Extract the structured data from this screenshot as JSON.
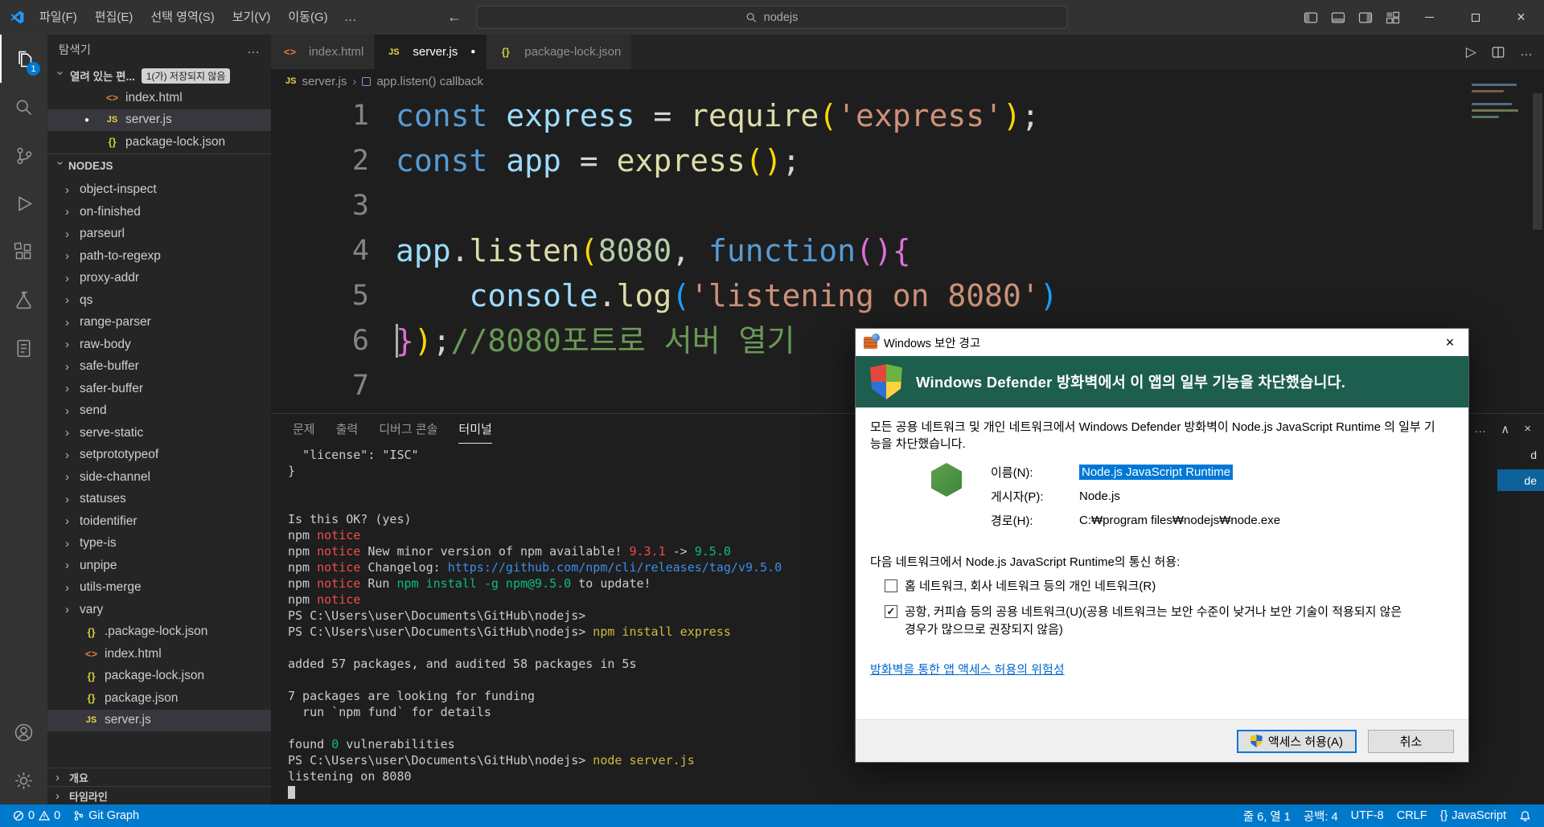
{
  "glyphs": {
    "more": "…",
    "close": "×",
    "back": "←",
    "forward": "→",
    "chevron_up": "∧",
    "run": "▷",
    "dot": "●"
  },
  "titlebar": {
    "menus": [
      "파일(F)",
      "편집(E)",
      "선택 영역(S)",
      "보기(V)",
      "이동(G)"
    ],
    "search": "nodejs"
  },
  "activitybar": {
    "explorer_badge": "1"
  },
  "sidebar": {
    "title": "탐색기",
    "open_editors": {
      "label": "열려 있는 편...",
      "badge": "1(가) 저장되지 않음"
    },
    "open_items": [
      {
        "name": "index.html",
        "icon": "html"
      },
      {
        "name": "server.js",
        "icon": "js",
        "modified": true,
        "selected": true
      },
      {
        "name": "package-lock.json",
        "icon": "json"
      }
    ],
    "project_label": "NODEJS",
    "folders": [
      "object-inspect",
      "on-finished",
      "parseurl",
      "path-to-regexp",
      "proxy-addr",
      "qs",
      "range-parser",
      "raw-body",
      "safe-buffer",
      "safer-buffer",
      "send",
      "serve-static",
      "setprototypeof",
      "side-channel",
      "statuses",
      "toidentifier",
      "type-is",
      "unpipe",
      "utils-merge",
      "vary"
    ],
    "files": [
      {
        "name": ".package-lock.json",
        "icon": "json"
      },
      {
        "name": "index.html",
        "icon": "html"
      },
      {
        "name": "package-lock.json",
        "icon": "json"
      },
      {
        "name": "package.json",
        "icon": "json"
      },
      {
        "name": "server.js",
        "icon": "js",
        "selected": true
      }
    ],
    "bottom_sections": [
      "개요",
      "타임라인"
    ]
  },
  "tabs": [
    {
      "name": "index.html",
      "icon": "html"
    },
    {
      "name": "server.js",
      "icon": "js",
      "active": true,
      "modified": true
    },
    {
      "name": "package-lock.json",
      "icon": "json"
    }
  ],
  "breadcrumb": {
    "file": "server.js",
    "symbol": "app.listen() callback"
  },
  "editor": {
    "lines": [
      {
        "n": "1",
        "t": [
          [
            "kw",
            "const"
          ],
          [
            "pl",
            " "
          ],
          [
            "vr",
            "express"
          ],
          [
            "pl",
            " = "
          ],
          [
            "fn",
            "require"
          ],
          [
            "b1",
            "("
          ],
          [
            "st",
            "'express'"
          ],
          [
            "b1",
            ")"
          ],
          [
            "pl",
            ";"
          ]
        ]
      },
      {
        "n": "2",
        "t": [
          [
            "kw",
            "const"
          ],
          [
            "pl",
            " "
          ],
          [
            "vr",
            "app"
          ],
          [
            "pl",
            " = "
          ],
          [
            "fn",
            "express"
          ],
          [
            "b1",
            "()"
          ],
          [
            "pl",
            ";"
          ]
        ]
      },
      {
        "n": "3",
        "t": []
      },
      {
        "n": "4",
        "t": [
          [
            "vr",
            "app"
          ],
          [
            "pl",
            "."
          ],
          [
            "fn",
            "listen"
          ],
          [
            "b1",
            "("
          ],
          [
            "nu",
            "8080"
          ],
          [
            "pl",
            ", "
          ],
          [
            "kw",
            "function"
          ],
          [
            "b2",
            "(){"
          ]
        ]
      },
      {
        "n": "5",
        "t": [
          [
            "pl",
            "    "
          ],
          [
            "vr",
            "console"
          ],
          [
            "pl",
            "."
          ],
          [
            "fn",
            "log"
          ],
          [
            "b3",
            "("
          ],
          [
            "st",
            "'listening on 8080'"
          ],
          [
            "b3",
            ")"
          ]
        ]
      },
      {
        "n": "6",
        "caret": true,
        "t": [
          [
            "b2",
            "}"
          ],
          [
            "b1",
            ")"
          ],
          [
            "pl",
            ";"
          ],
          [
            "cm",
            "//8080포트로 서버 열기"
          ]
        ]
      },
      {
        "n": "7",
        "t": []
      }
    ]
  },
  "panel": {
    "tabs": [
      {
        "label": "문제"
      },
      {
        "label": "출력"
      },
      {
        "label": "디버그 콘솔"
      },
      {
        "label": "터미널",
        "active": true
      }
    ],
    "frag_rows": [
      {
        "text": "d"
      },
      {
        "text": "de",
        "selected": true
      }
    ]
  },
  "terminal": {
    "lines": [
      [
        [
          "d",
          "  \"license\": \"ISC\""
        ]
      ],
      [
        [
          "d",
          "}"
        ]
      ],
      [],
      [],
      [
        [
          "d",
          "Is this OK? (yes)"
        ]
      ],
      [
        [
          "d",
          "npm "
        ],
        [
          "r",
          "notice"
        ]
      ],
      [
        [
          "d",
          "npm "
        ],
        [
          "r",
          "notice"
        ],
        [
          "d",
          " New minor version of npm available! "
        ],
        [
          "r",
          "9.3.1"
        ],
        [
          "d",
          " -> "
        ],
        [
          "g",
          "9.5.0"
        ]
      ],
      [
        [
          "d",
          "npm "
        ],
        [
          "r",
          "notice"
        ],
        [
          "d",
          " Changelog: "
        ],
        [
          "b",
          "https://github.com/npm/cli/releases/tag/v9.5.0"
        ]
      ],
      [
        [
          "d",
          "npm "
        ],
        [
          "r",
          "notice"
        ],
        [
          "d",
          " Run "
        ],
        [
          "g",
          "npm install -g npm@9.5.0"
        ],
        [
          "d",
          " to update!"
        ]
      ],
      [
        [
          "d",
          "npm "
        ],
        [
          "r",
          "notice"
        ]
      ],
      [
        [
          "d",
          "PS C:\\Users\\user\\Documents\\GitHub\\nodejs>"
        ]
      ],
      [
        [
          "d",
          "PS C:\\Users\\user\\Documents\\GitHub\\nodejs> "
        ],
        [
          "y",
          "npm install express"
        ]
      ],
      [],
      [
        [
          "d",
          "added 57 packages, and audited 58 packages in 5s"
        ]
      ],
      [],
      [
        [
          "d",
          "7 packages are looking for funding"
        ]
      ],
      [
        [
          "d",
          "  run `npm fund` for details"
        ]
      ],
      [],
      [
        [
          "d",
          "found "
        ],
        [
          "g",
          "0"
        ],
        [
          "d",
          " vulnerabilities"
        ]
      ],
      [
        [
          "d",
          "PS C:\\Users\\user\\Documents\\GitHub\\nodejs> "
        ],
        [
          "y",
          "node server.js"
        ]
      ],
      [
        [
          "d",
          "listening on 8080"
        ]
      ],
      [
        [
          "cur",
          " "
        ]
      ]
    ]
  },
  "statusbar": {
    "errors": "0",
    "warnings": "0",
    "git_graph": "Git Graph",
    "line_col": "줄 6, 열 1",
    "spaces": "공백: 4",
    "encoding": "UTF-8",
    "eol": "CRLF",
    "lang_icon": "{}",
    "language": "JavaScript"
  },
  "dialog": {
    "title": "Windows 보안 경고",
    "banner": "Windows Defender 방화벽에서 이 앱의 일부 기능을 차단했습니다.",
    "body_text": "모든 공용 네트워크 및 개인 네트워크에서 Windows Defender 방화벽이 Node.js JavaScript Runtime 의 일부 기능을 차단했습니다.",
    "fields": [
      {
        "label": "이름(N):",
        "value": "Node.js JavaScript Runtime",
        "highlight": true
      },
      {
        "label": "게시자(P):",
        "value": "Node.js"
      },
      {
        "label": "경로(H):",
        "value": "C:₩program files₩nodejs₩node.exe"
      }
    ],
    "allow_text": "다음 네트워크에서 Node.js JavaScript Runtime의 통신 허용:",
    "checkboxes": [
      {
        "checked": false,
        "label": "홈 네트워크, 회사 네트워크 등의 개인 네트워크(R)"
      },
      {
        "checked": true,
        "label": "공항, 커피숍 등의 공용 네트워크(U)(공용 네트워크는 보안 수준이 낮거나 보안 기술이 적용되지 않은 경우가 많으므로 권장되지 않음)"
      }
    ],
    "link": "방화벽을 통한 앱 액세스 허용의 위험성",
    "allow_button": "액세스 허용(A)",
    "cancel_button": "취소"
  }
}
